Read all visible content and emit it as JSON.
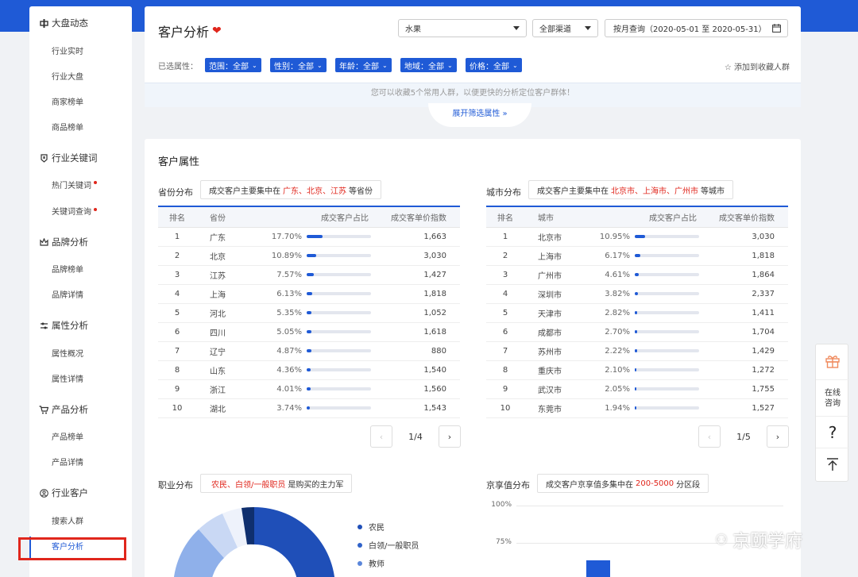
{
  "sidebar": {
    "sections": [
      {
        "label": "大盘动态",
        "items": [
          "行业实时",
          "行业大盘",
          "商家榜单",
          "商品榜单"
        ]
      },
      {
        "label": "行业关键词",
        "items": [
          "热门关键词",
          "关键词查询"
        ]
      },
      {
        "label": "品牌分析",
        "items": [
          "品牌榜单",
          "品牌详情"
        ]
      },
      {
        "label": "属性分析",
        "items": [
          "属性概况",
          "属性详情"
        ]
      },
      {
        "label": "产品分析",
        "items": [
          "产品榜单",
          "产品详情"
        ]
      },
      {
        "label": "行业客户",
        "items": [
          "搜索人群",
          "客户分析"
        ]
      }
    ],
    "active_item": "客户分析",
    "highlight_color": "#e0261c"
  },
  "header": {
    "title": "客户分析",
    "category_select": "水果",
    "channel_select": "全部渠道",
    "date_select": "按月查询（2020-05-01 至 2020-05-31）",
    "attr_label": "已选属性：",
    "tags": [
      "范围：全部",
      "性别：全部",
      "年龄：全部",
      "地域：全部",
      "价格：全部"
    ],
    "favorite_label": "添加到收藏人群",
    "tip": "您可以收藏5个常用人群，以便更快的分析定位客户群体！",
    "expand_label": "展开筛选属性"
  },
  "main": {
    "title": "客户属性",
    "province": {
      "label": "省份分布",
      "summary_prefix": "成交客户主要集中在",
      "summary_highlight": "广东、北京、江苏",
      "summary_suffix": "等省份",
      "columns": [
        "排名",
        "省份",
        "成交客户占比",
        "成交客单价指数"
      ],
      "rows": [
        {
          "rank": "1",
          "name": "广东",
          "pct": "17.70%",
          "share": 0.177,
          "idx": "1,663"
        },
        {
          "rank": "2",
          "name": "北京",
          "pct": "10.89%",
          "share": 0.1089,
          "idx": "3,030"
        },
        {
          "rank": "3",
          "name": "江苏",
          "pct": "7.57%",
          "share": 0.0757,
          "idx": "1,427"
        },
        {
          "rank": "4",
          "name": "上海",
          "pct": "6.13%",
          "share": 0.0613,
          "idx": "1,818"
        },
        {
          "rank": "5",
          "name": "河北",
          "pct": "5.35%",
          "share": 0.0535,
          "idx": "1,052"
        },
        {
          "rank": "6",
          "name": "四川",
          "pct": "5.05%",
          "share": 0.0505,
          "idx": "1,618"
        },
        {
          "rank": "7",
          "name": "辽宁",
          "pct": "4.87%",
          "share": 0.0487,
          "idx": "880"
        },
        {
          "rank": "8",
          "name": "山东",
          "pct": "4.36%",
          "share": 0.0436,
          "idx": "1,540"
        },
        {
          "rank": "9",
          "name": "浙江",
          "pct": "4.01%",
          "share": 0.0401,
          "idx": "1,560"
        },
        {
          "rank": "10",
          "name": "湖北",
          "pct": "3.74%",
          "share": 0.0374,
          "idx": "1,543"
        }
      ],
      "page": "1/4"
    },
    "city": {
      "label": "城市分布",
      "summary_prefix": "成交客户主要集中在",
      "summary_highlight": "北京市、上海市、广州市",
      "summary_suffix": "等城市",
      "columns": [
        "排名",
        "城市",
        "成交客户占比",
        "成交客单价指数"
      ],
      "rows": [
        {
          "rank": "1",
          "name": "北京市",
          "pct": "10.95%",
          "share": 0.1095,
          "idx": "3,030"
        },
        {
          "rank": "2",
          "name": "上海市",
          "pct": "6.17%",
          "share": 0.0617,
          "idx": "1,818"
        },
        {
          "rank": "3",
          "name": "广州市",
          "pct": "4.61%",
          "share": 0.0461,
          "idx": "1,864"
        },
        {
          "rank": "4",
          "name": "深圳市",
          "pct": "3.82%",
          "share": 0.0382,
          "idx": "2,337"
        },
        {
          "rank": "5",
          "name": "天津市",
          "pct": "2.82%",
          "share": 0.0282,
          "idx": "1,411"
        },
        {
          "rank": "6",
          "name": "成都市",
          "pct": "2.70%",
          "share": 0.027,
          "idx": "1,704"
        },
        {
          "rank": "7",
          "name": "苏州市",
          "pct": "2.22%",
          "share": 0.0222,
          "idx": "1,429"
        },
        {
          "rank": "8",
          "name": "重庆市",
          "pct": "2.10%",
          "share": 0.021,
          "idx": "1,272"
        },
        {
          "rank": "9",
          "name": "武汉市",
          "pct": "2.05%",
          "share": 0.0205,
          "idx": "1,755"
        },
        {
          "rank": "10",
          "name": "东莞市",
          "pct": "1.94%",
          "share": 0.0194,
          "idx": "1,527"
        }
      ],
      "page": "1/5"
    },
    "occupation": {
      "label": "职业分布",
      "summary_highlight": "农民、白领/一般职员",
      "summary_suffix": "是购买的主力军",
      "legend": [
        {
          "name": "农民",
          "color": "#1f4fb8"
        },
        {
          "name": "白领/一般职员",
          "color": "#2f62c9"
        },
        {
          "name": "教师",
          "color": "#5a86da"
        }
      ]
    },
    "jingxiang": {
      "label": "京享值分布",
      "summary_prefix": "成交客户京享值多集中在",
      "summary_highlight": "200-5000",
      "summary_suffix": "分区段",
      "axis_ticks": [
        "100%",
        "75%"
      ]
    }
  },
  "float": {
    "online_label": "在线咨询",
    "help": "?",
    "top": "不"
  },
  "watermark": "京颐学府",
  "colors": {
    "accent": "#1f5ad6",
    "red": "#e0261c"
  }
}
